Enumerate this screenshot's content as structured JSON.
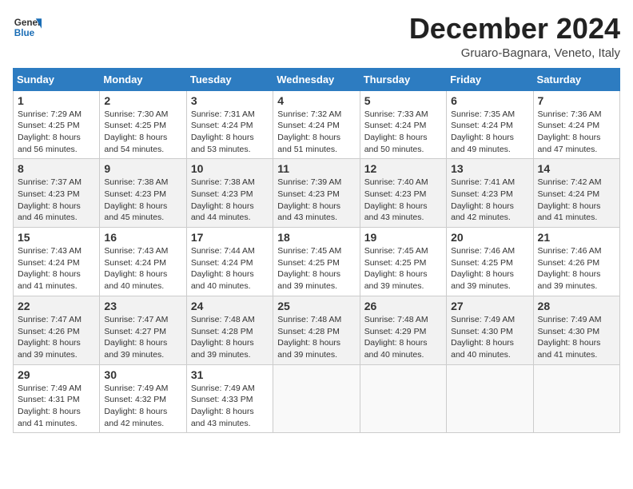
{
  "header": {
    "logo_line1": "General",
    "logo_line2": "Blue",
    "title": "December 2024",
    "subtitle": "Gruaro-Bagnara, Veneto, Italy"
  },
  "weekdays": [
    "Sunday",
    "Monday",
    "Tuesday",
    "Wednesday",
    "Thursday",
    "Friday",
    "Saturday"
  ],
  "weeks": [
    [
      {
        "day": "1",
        "info": "Sunrise: 7:29 AM\nSunset: 4:25 PM\nDaylight: 8 hours\nand 56 minutes."
      },
      {
        "day": "2",
        "info": "Sunrise: 7:30 AM\nSunset: 4:25 PM\nDaylight: 8 hours\nand 54 minutes."
      },
      {
        "day": "3",
        "info": "Sunrise: 7:31 AM\nSunset: 4:24 PM\nDaylight: 8 hours\nand 53 minutes."
      },
      {
        "day": "4",
        "info": "Sunrise: 7:32 AM\nSunset: 4:24 PM\nDaylight: 8 hours\nand 51 minutes."
      },
      {
        "day": "5",
        "info": "Sunrise: 7:33 AM\nSunset: 4:24 PM\nDaylight: 8 hours\nand 50 minutes."
      },
      {
        "day": "6",
        "info": "Sunrise: 7:35 AM\nSunset: 4:24 PM\nDaylight: 8 hours\nand 49 minutes."
      },
      {
        "day": "7",
        "info": "Sunrise: 7:36 AM\nSunset: 4:24 PM\nDaylight: 8 hours\nand 47 minutes."
      }
    ],
    [
      {
        "day": "8",
        "info": "Sunrise: 7:37 AM\nSunset: 4:23 PM\nDaylight: 8 hours\nand 46 minutes."
      },
      {
        "day": "9",
        "info": "Sunrise: 7:38 AM\nSunset: 4:23 PM\nDaylight: 8 hours\nand 45 minutes."
      },
      {
        "day": "10",
        "info": "Sunrise: 7:38 AM\nSunset: 4:23 PM\nDaylight: 8 hours\nand 44 minutes."
      },
      {
        "day": "11",
        "info": "Sunrise: 7:39 AM\nSunset: 4:23 PM\nDaylight: 8 hours\nand 43 minutes."
      },
      {
        "day": "12",
        "info": "Sunrise: 7:40 AM\nSunset: 4:23 PM\nDaylight: 8 hours\nand 43 minutes."
      },
      {
        "day": "13",
        "info": "Sunrise: 7:41 AM\nSunset: 4:23 PM\nDaylight: 8 hours\nand 42 minutes."
      },
      {
        "day": "14",
        "info": "Sunrise: 7:42 AM\nSunset: 4:24 PM\nDaylight: 8 hours\nand 41 minutes."
      }
    ],
    [
      {
        "day": "15",
        "info": "Sunrise: 7:43 AM\nSunset: 4:24 PM\nDaylight: 8 hours\nand 41 minutes."
      },
      {
        "day": "16",
        "info": "Sunrise: 7:43 AM\nSunset: 4:24 PM\nDaylight: 8 hours\nand 40 minutes."
      },
      {
        "day": "17",
        "info": "Sunrise: 7:44 AM\nSunset: 4:24 PM\nDaylight: 8 hours\nand 40 minutes."
      },
      {
        "day": "18",
        "info": "Sunrise: 7:45 AM\nSunset: 4:25 PM\nDaylight: 8 hours\nand 39 minutes."
      },
      {
        "day": "19",
        "info": "Sunrise: 7:45 AM\nSunset: 4:25 PM\nDaylight: 8 hours\nand 39 minutes."
      },
      {
        "day": "20",
        "info": "Sunrise: 7:46 AM\nSunset: 4:25 PM\nDaylight: 8 hours\nand 39 minutes."
      },
      {
        "day": "21",
        "info": "Sunrise: 7:46 AM\nSunset: 4:26 PM\nDaylight: 8 hours\nand 39 minutes."
      }
    ],
    [
      {
        "day": "22",
        "info": "Sunrise: 7:47 AM\nSunset: 4:26 PM\nDaylight: 8 hours\nand 39 minutes."
      },
      {
        "day": "23",
        "info": "Sunrise: 7:47 AM\nSunset: 4:27 PM\nDaylight: 8 hours\nand 39 minutes."
      },
      {
        "day": "24",
        "info": "Sunrise: 7:48 AM\nSunset: 4:28 PM\nDaylight: 8 hours\nand 39 minutes."
      },
      {
        "day": "25",
        "info": "Sunrise: 7:48 AM\nSunset: 4:28 PM\nDaylight: 8 hours\nand 39 minutes."
      },
      {
        "day": "26",
        "info": "Sunrise: 7:48 AM\nSunset: 4:29 PM\nDaylight: 8 hours\nand 40 minutes."
      },
      {
        "day": "27",
        "info": "Sunrise: 7:49 AM\nSunset: 4:30 PM\nDaylight: 8 hours\nand 40 minutes."
      },
      {
        "day": "28",
        "info": "Sunrise: 7:49 AM\nSunset: 4:30 PM\nDaylight: 8 hours\nand 41 minutes."
      }
    ],
    [
      {
        "day": "29",
        "info": "Sunrise: 7:49 AM\nSunset: 4:31 PM\nDaylight: 8 hours\nand 41 minutes."
      },
      {
        "day": "30",
        "info": "Sunrise: 7:49 AM\nSunset: 4:32 PM\nDaylight: 8 hours\nand 42 minutes."
      },
      {
        "day": "31",
        "info": "Sunrise: 7:49 AM\nSunset: 4:33 PM\nDaylight: 8 hours\nand 43 minutes."
      },
      {
        "day": "",
        "info": ""
      },
      {
        "day": "",
        "info": ""
      },
      {
        "day": "",
        "info": ""
      },
      {
        "day": "",
        "info": ""
      }
    ]
  ]
}
